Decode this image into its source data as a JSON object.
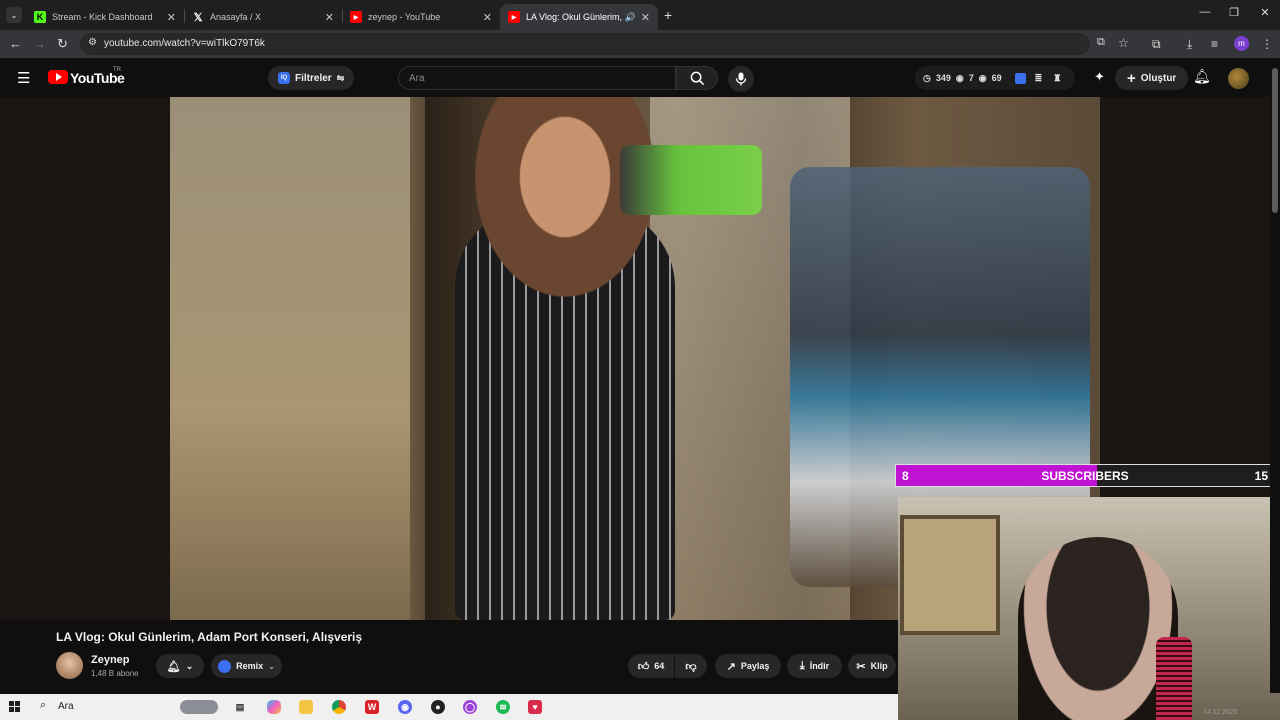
{
  "browser": {
    "tabs": [
      {
        "title": "Stream - Kick Dashboard",
        "favicon": "kick-icon",
        "color": "#53fc18"
      },
      {
        "title": "Anasayfa / X",
        "favicon": "x-icon",
        "color": "#ffffff"
      },
      {
        "title": "zeynep - YouTube",
        "favicon": "youtube-icon",
        "color": "#ff0000"
      },
      {
        "title": "LA Vlog: Okul Günlerim, Ad",
        "favicon": "youtube-icon",
        "color": "#ff0000",
        "active": true
      }
    ],
    "url": "youtube.com/watch?v=wiTlkO79T6k"
  },
  "youtube": {
    "logo_text": "YouTube",
    "country": "TR",
    "filters_label": "Filtreler",
    "search_placeholder": "Ara",
    "stats": {
      "a": "349",
      "b": "7",
      "c": "69"
    },
    "create_label": "Oluştur"
  },
  "overlay": {
    "sub_left": "8",
    "sub_title": "SUBSCRIBERS",
    "sub_right": "15",
    "progress_fraction": 0.533,
    "bar_color": "#c012d3"
  },
  "video": {
    "title": "LA Vlog: Okul Günlerim, Adam Port Konseri, Alışveriş",
    "channel_name": "Zeynep",
    "channel_subs": "1,48 B abone",
    "remix_label": "Remix",
    "likes": "64",
    "share_label": "Paylaş",
    "download_label": "İndir",
    "clip_label": "Klip"
  },
  "taskbar": {
    "search_label": "Ara",
    "date": "14.11.2025"
  }
}
